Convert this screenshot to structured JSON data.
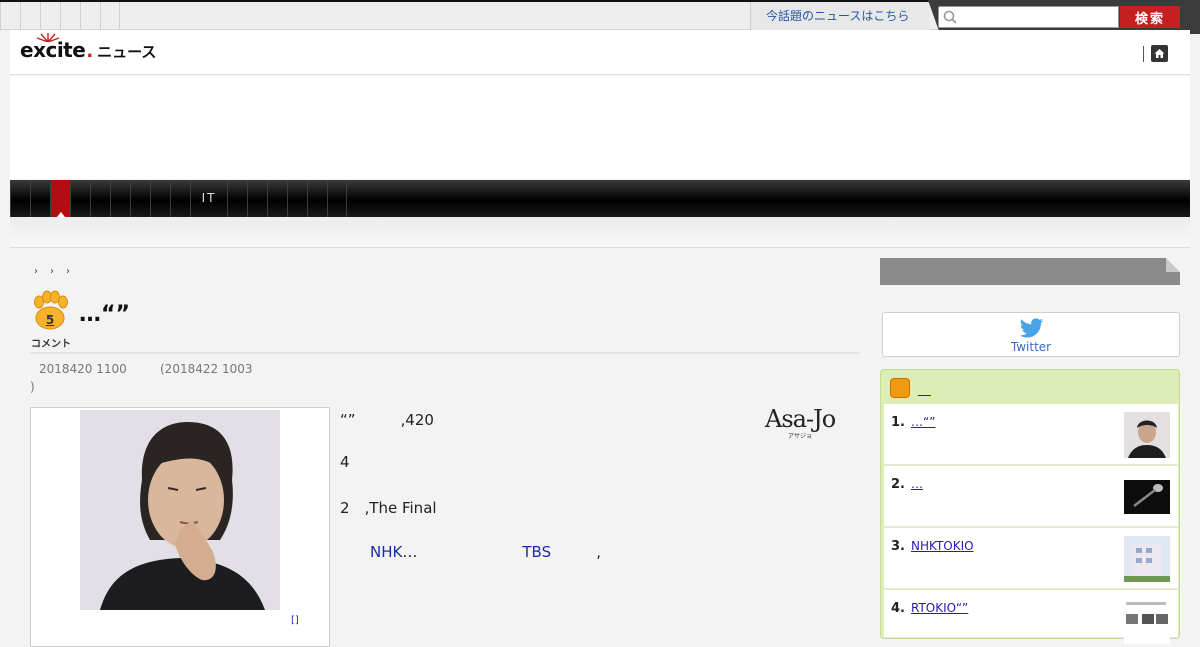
{
  "topbar": {
    "topnews_link": "今話題のニュースはこちら",
    "search_placeholder": "",
    "search_button": "検索"
  },
  "header": {
    "logo_brand": "excite",
    "logo_suffix": "ニュース"
  },
  "category_nav": {
    "items": [
      "",
      "",
      "",
      "",
      "",
      "",
      "",
      "",
      "",
      "IT",
      "",
      "",
      "",
      "",
      "",
      ""
    ],
    "active_index": 2
  },
  "breadcrumb": [
    "›",
    "›",
    "›"
  ],
  "article": {
    "comment_count": "5",
    "comment_label": "コメント",
    "title": "…“”",
    "published": "2018420 1100",
    "updated": "(2018422 1003",
    "updated_close": ")",
    "photo_credit": "[]",
    "paragraphs": [
      {
        "text": "“”　　　‚420"
      },
      {
        "text": "4"
      },
      {
        "text": "2　‚The Final"
      }
    ],
    "para4_pre": "　　",
    "para4_link1": "NHK",
    "para4_mid": "…　　　　　　　",
    "para4_link2": "TBS",
    "para4_post": "　　　‚",
    "source_logo": "Asa-Jo",
    "source_logo_sub": "アサジョ"
  },
  "sidebar": {
    "twitter_label": "Twitter",
    "ranking_header": "",
    "ranking": [
      {
        "num": "1.",
        "title": "…“”"
      },
      {
        "num": "2.",
        "title": "…"
      },
      {
        "num": "3.",
        "title": "NHKTOKIO"
      },
      {
        "num": "4.",
        "title": "RTOKIO“”"
      }
    ]
  },
  "colors": {
    "brand_red": "#c51f20",
    "ranking_bg": "#dcedb5",
    "link_blue": "#1a2aa8"
  }
}
